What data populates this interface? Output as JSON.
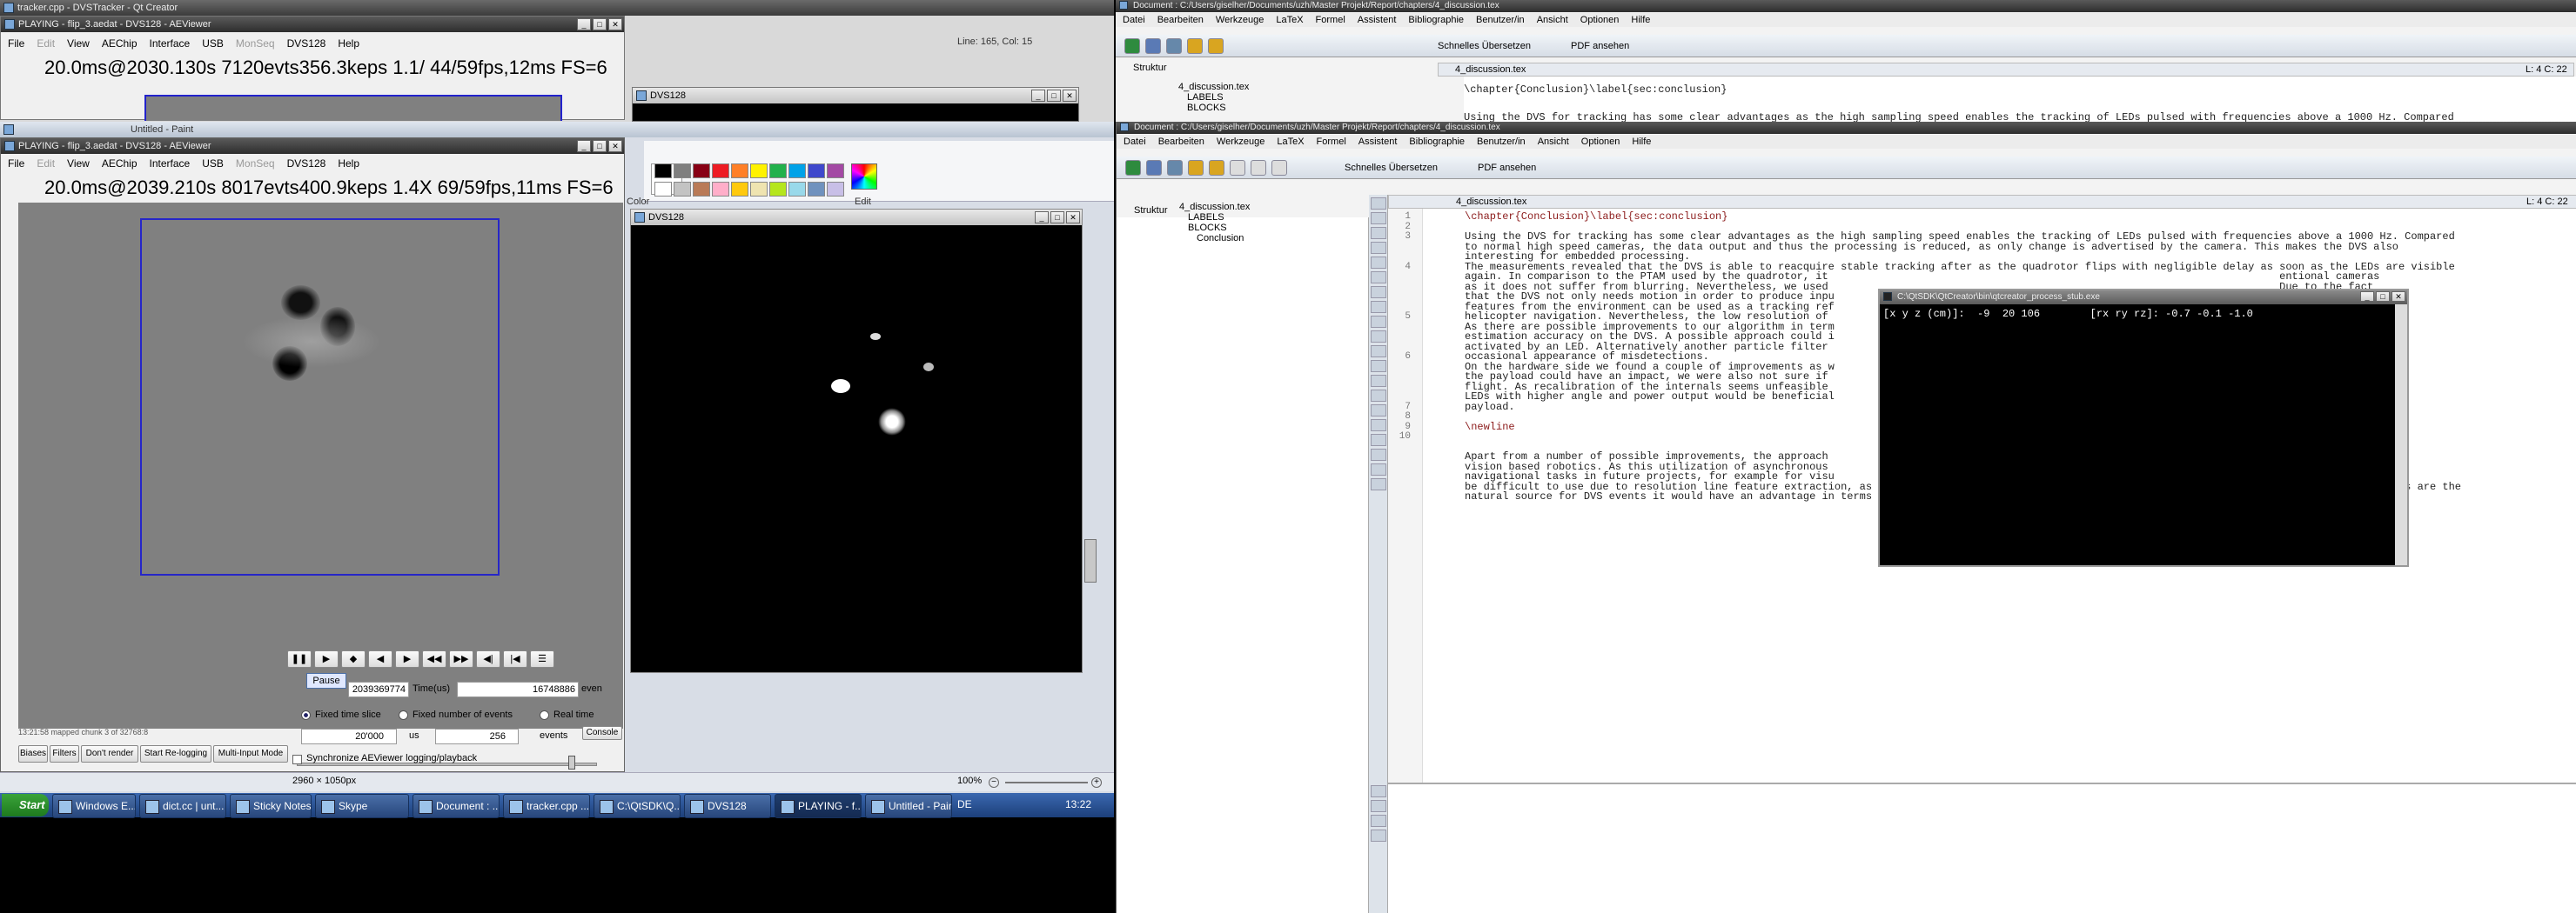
{
  "qtcreator": {
    "title": "tracker.cpp - DVSTracker - Qt Creator",
    "line_col": "Line: 165, Col: 15"
  },
  "aeviewer_back": {
    "title": "PLAYING - flip_3.aedat - DVS128 - AEViewer",
    "menu": [
      "File",
      "Edit",
      "View",
      "AEChip",
      "Interface",
      "USB",
      "MonSeq",
      "DVS128",
      "Help"
    ],
    "stats": "20.0ms@2030.130s   7120evts356.3keps   1.1/   44/59fps,12ms FS=6"
  },
  "dvs128_back": {
    "title": "DVS128"
  },
  "paint": {
    "title": "Untitled - Paint",
    "color_label": "Color",
    "edit_label": "Edit",
    "palette": [
      "#000000",
      "#7f7f7f",
      "#880015",
      "#ed1c24",
      "#ff7f27",
      "#fff200",
      "#22b14c",
      "#00a2e8",
      "#3f48cc",
      "#a349a4",
      "#ffffff",
      "#c3c3c3",
      "#b97a57",
      "#ffaec9",
      "#ffc90e",
      "#efe4b0",
      "#b5e61d",
      "#99d9ea",
      "#7092be",
      "#c8bfe7"
    ],
    "status_size": "2960 × 1050px",
    "zoom": "100%"
  },
  "aeviewer": {
    "title": "PLAYING - flip_3.aedat - DVS128 - AEViewer",
    "menu": [
      "File",
      "Edit",
      "View",
      "AEChip",
      "Interface",
      "USB",
      "MonSeq",
      "DVS128",
      "Help"
    ],
    "stats": "20.0ms@2039.210s   8017evts400.9keps   1.4X   69/59fps,11ms FS=6",
    "status_msg": "13:21:58 mapped chunk 3 of 32768:8",
    "console": "Console",
    "tabs": [
      "Biases",
      "Filters",
      "Don't render",
      "Start Re-logging",
      "Multi-Input Mode"
    ],
    "pause_tooltip": "Pause",
    "time_value": "2039369774",
    "time_label": "Time(us)",
    "event_value": "16748886",
    "event_label": "even",
    "radio_fixed_time": "Fixed time slice",
    "radio_fixed_events": "Fixed number of events",
    "radio_real_time": "Real time",
    "slice_value": "20'000",
    "slice_unit": "us",
    "events_value": "256",
    "events_unit": "events",
    "sync_label": "Synchronize AEViewer logging/playback"
  },
  "dvs128": {
    "title": "DVS128"
  },
  "texmaker_back": {
    "title": "Document : C:/Users/giselher/Documents/uzh/Master Projekt/Report/chapters/4_discussion.tex",
    "menu": [
      "Datei",
      "Bearbeiten",
      "Werkzeuge",
      "LaTeX",
      "Formel",
      "Assistent",
      "Bibliographie",
      "Benutzer/in",
      "Ansicht",
      "Optionen",
      "Hilfe"
    ],
    "quick_build": "Schnelles Übersetzen",
    "pdf_view": "PDF ansehen",
    "struct_label": "Struktur",
    "file_tab": "4_discussion.tex",
    "pos": "L: 4 C: 22",
    "tree": [
      "4_discussion.tex",
      "LABELS",
      "BLOCKS"
    ],
    "line1": "\\chapter{Conclusion}\\label{sec:conclusion}",
    "line3": "Using the DVS for tracking has some clear advantages as the high sampling speed enables the tracking of LEDs pulsed with frequencies above a 1000 Hz. Compared"
  },
  "texmaker": {
    "title": "Document : C:/Users/giselher/Documents/uzh/Master Projekt/Report/chapters/4_discussion.tex",
    "menu": [
      "Datei",
      "Bearbeiten",
      "Werkzeuge",
      "LaTeX",
      "Formel",
      "Assistent",
      "Bibliographie",
      "Benutzer/in",
      "Ansicht",
      "Optionen",
      "Hilfe"
    ],
    "quick_build": "Schnelles Übersetzen",
    "pdf_view": "PDF ansehen",
    "struct_label": "Struktur",
    "file_tab": "4_discussion.tex",
    "pos": "L: 4 C: 22",
    "tree": [
      "4_discussion.tex",
      "LABELS",
      "BLOCKS",
      "Conclusion"
    ],
    "line_numbers": [
      "1",
      "2",
      "3",
      "",
      "",
      "4",
      "",
      "",
      "",
      "",
      "5",
      "",
      "",
      "",
      "6",
      "",
      "",
      "",
      "",
      "7",
      "8",
      "9",
      "10"
    ],
    "code_lines": [
      "\\chapter{Conclusion}\\label{sec:conclusion}",
      "",
      "Using the DVS for tracking has some clear advantages as the high sampling speed enables the tracking of LEDs pulsed with frequencies above a 1000 Hz. Compared",
      "to normal high speed cameras, the data output and thus the processing is reduced, as only change is advertised by the camera. This makes the DVS also",
      "interesting for embedded processing.",
      "The measurements revealed that the DVS is able to reacquire stable tracking after as the quadrotor flips with negligible delay as soon as the LEDs are visible",
      "again. In comparison to the PTAM used by the quadrotor, it                                                                        entional cameras",
      "as it does not suffer from blurring. Nevertheless, we used                                                                        Due to the fact",
      "that the DVS not only needs motion in order to produce inpu                                                                       yet, how well",
      "features from the environment can be used as a tracking ref                                                                       s perform well in",
      "helicopter navigation. Nevertheless, the low resolution of",
      "As there are possible improvements to our algorithm in term                                                                       the pose",
      "estimation accuracy on the DVS. A possible approach could i                                                                       eral pixels",
      "activated by an LED. Alternatively another particle filter                                                                         help with the",
      "occasional appearance of misdetections.",
      "On the hardware side we found a couple of improvements as w                                                                       better balancing",
      "the payload could have an impact, we were also not sure if                                                                         the unstable",
      "flight. As recalibration of the internals seems unfeasible                                                                         y of the markers,",
      "LEDs with higher angle and power output would be beneficial                                                                        in terms of",
      "payload.",
      "",
      "\\newline",
      "",
      "",
      "Apart from a number of possible improvements, the approach                                                                         ven approach for",
      "vision based robotics. As this utilization of asynchronous                                                                         amera in other",
      "navigational tasks in future projects, for example for visu                                                                        ite(SIFT) might",
      "be difficult to use due to resolution line feature extraction, as describe in \\cite{linetracking}, could be a feasible approach. Additionally, as edges are the",
      "natural source for DVS events it would have an advantage in terms of processing compared to normal cameras."
    ]
  },
  "terminal": {
    "title": "C:\\QtSDK\\QtCreator\\bin\\qtcreator_process_stub.exe",
    "line1": "[x y z (cm)]:  -9  20 106        [rx ry rz]: -0.7 -0.1 -1.0"
  },
  "taskbar": {
    "start": "Start",
    "items": [
      "Windows E...",
      "dict.cc | unt...",
      "Sticky Notes",
      "Skype",
      "Document : ...",
      "tracker.cpp ...",
      "C:\\QtSDK\\Q...",
      "DVS128",
      "PLAYING - f...",
      "Untitled - Paint"
    ],
    "lang": "DE",
    "time": "13:22"
  }
}
